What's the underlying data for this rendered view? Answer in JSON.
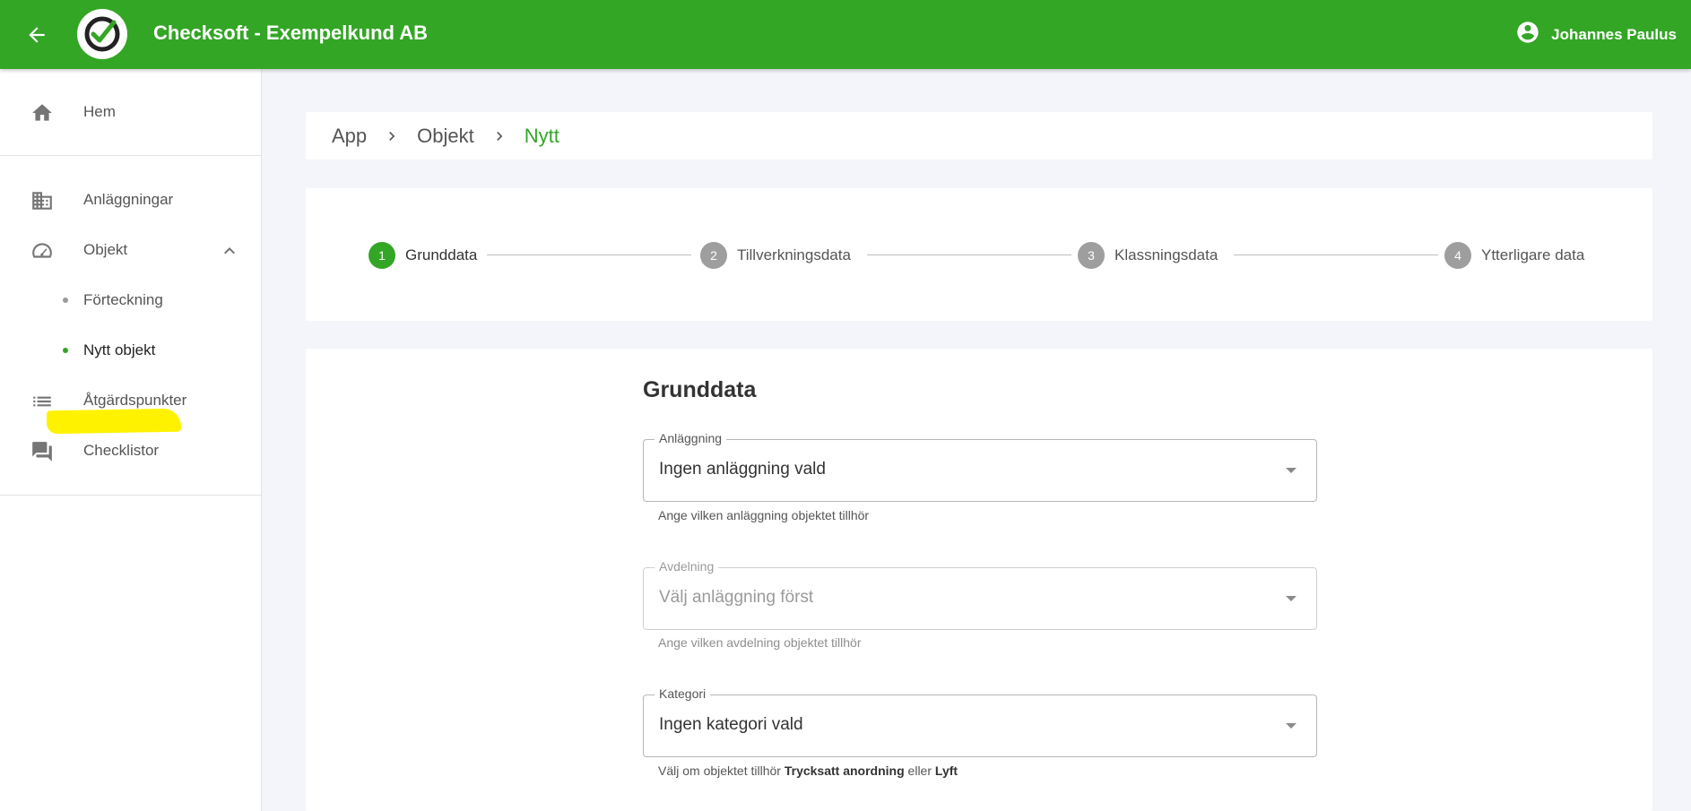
{
  "header": {
    "title": "Checksoft - Exempelkund AB",
    "user_name": "Johannes Paulus",
    "brand_color": "#33a625"
  },
  "sidebar": {
    "items": [
      {
        "label": "Hem",
        "icon": "home-icon"
      },
      {
        "label": "Anläggningar",
        "icon": "building-icon"
      },
      {
        "label": "Objekt",
        "icon": "speedometer-icon",
        "expanded": true
      },
      {
        "label": "Förteckning",
        "sub": true
      },
      {
        "label": "Nytt objekt",
        "sub": true,
        "active": true,
        "highlighted": true
      },
      {
        "label": "Åtgärdspunkter",
        "icon": "list-icon"
      },
      {
        "label": "Checklistor",
        "icon": "forum-icon"
      }
    ]
  },
  "breadcrumb": {
    "items": [
      "App",
      "Objekt",
      "Nytt"
    ]
  },
  "stepper": {
    "steps": [
      {
        "num": "1",
        "label": "Grunddata",
        "active": true
      },
      {
        "num": "2",
        "label": "Tillverkningsdata"
      },
      {
        "num": "3",
        "label": "Klassningsdata"
      },
      {
        "num": "4",
        "label": "Ytterligare data"
      }
    ]
  },
  "form": {
    "title": "Grunddata",
    "fields": {
      "anlaggning": {
        "label": "Anläggning",
        "value": "Ingen anläggning vald",
        "hint": "Ange vilken anläggning objektet tillhör"
      },
      "avdelning": {
        "label": "Avdelning",
        "value": "Välj anläggning först",
        "hint": "Ange vilken avdelning objektet tillhör",
        "disabled": true
      },
      "kategori": {
        "label": "Kategori",
        "value": "Ingen kategori vald",
        "hint_prefix": "Välj om objektet tillhör",
        "hint_bold1": "Trycksatt anordning",
        "hint_mid": "eller",
        "hint_bold2": "Lyft"
      }
    }
  }
}
